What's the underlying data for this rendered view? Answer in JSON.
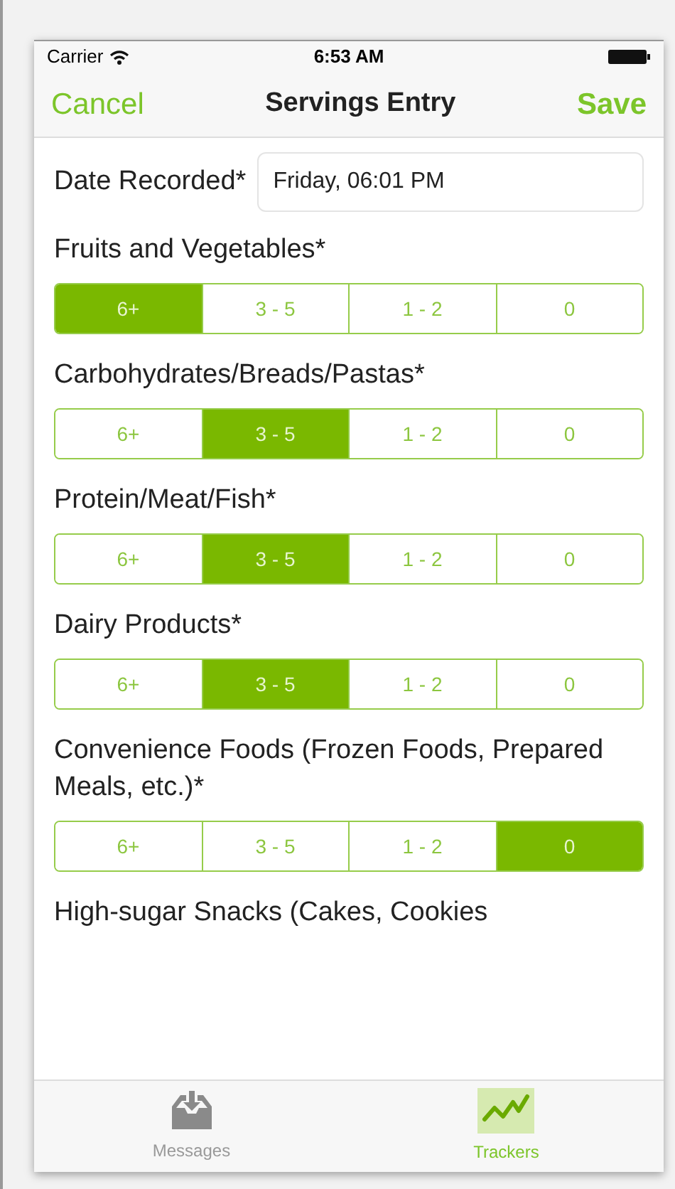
{
  "status_bar": {
    "carrier": "Carrier",
    "time": "6:53 AM"
  },
  "nav": {
    "cancel": "Cancel",
    "title": "Servings Entry",
    "save": "Save"
  },
  "date": {
    "label": "Date Recorded*",
    "value": "Friday, 06:01 PM"
  },
  "questions": [
    {
      "label": "Fruits and Vegetables*",
      "options": [
        {
          "label": "6+",
          "selected": true
        },
        {
          "label": "3 - 5",
          "selected": false
        },
        {
          "label": "1 - 2",
          "selected": false
        },
        {
          "label": "0",
          "selected": false
        }
      ]
    },
    {
      "label": "Carbohydrates/Breads/Pastas*",
      "options": [
        {
          "label": "6+",
          "selected": false
        },
        {
          "label": "3 - 5",
          "selected": true
        },
        {
          "label": "1 - 2",
          "selected": false
        },
        {
          "label": "0",
          "selected": false
        }
      ]
    },
    {
      "label": "Protein/Meat/Fish*",
      "options": [
        {
          "label": "6+",
          "selected": false
        },
        {
          "label": "3 - 5",
          "selected": true
        },
        {
          "label": "1 - 2",
          "selected": false
        },
        {
          "label": "0",
          "selected": false
        }
      ]
    },
    {
      "label": "Dairy Products*",
      "options": [
        {
          "label": "6+",
          "selected": false
        },
        {
          "label": "3 - 5",
          "selected": true
        },
        {
          "label": "1 - 2",
          "selected": false
        },
        {
          "label": "0",
          "selected": false
        }
      ]
    },
    {
      "label": "Convenience Foods (Frozen Foods, Prepared Meals, etc.)*",
      "options": [
        {
          "label": "6+",
          "selected": false
        },
        {
          "label": "3 - 5",
          "selected": false
        },
        {
          "label": "1 - 2",
          "selected": false
        },
        {
          "label": "0",
          "selected": true
        }
      ]
    },
    {
      "label": "High-sugar Snacks (Cakes, Cookies"
    }
  ],
  "tab_bar": [
    {
      "label": "Messages",
      "kind": "inbox",
      "selected": false
    },
    {
      "label": "Trackers",
      "kind": "chart",
      "selected": true
    }
  ]
}
